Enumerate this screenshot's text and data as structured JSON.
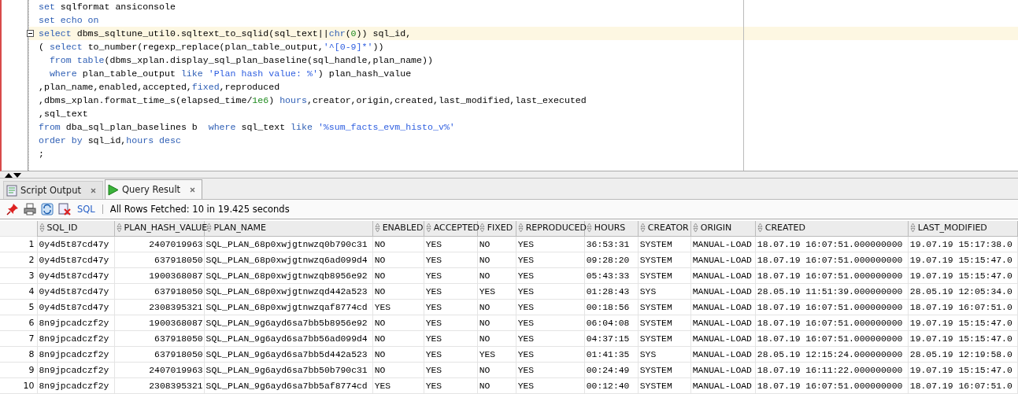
{
  "editor": {
    "lines": [
      {
        "current": false,
        "fold_marker": false,
        "tokens": [
          {
            "kind": "keyword",
            "text": "set"
          },
          {
            "kind": "plain",
            "text": " sqlformat ansiconsole"
          }
        ]
      },
      {
        "current": false,
        "fold_marker": false,
        "tokens": [
          {
            "kind": "keyword",
            "text": "set echo on"
          }
        ]
      },
      {
        "current": true,
        "fold_marker": true,
        "tokens": [
          {
            "kind": "keyword",
            "text": "select"
          },
          {
            "kind": "plain",
            "text": " dbms_sqltune_util0.sqltext_to_sqlid(sql_text||"
          },
          {
            "kind": "keyword",
            "text": "chr"
          },
          {
            "kind": "plain",
            "text": "("
          },
          {
            "kind": "number",
            "text": "0"
          },
          {
            "kind": "plain",
            "text": ")) sql_id,"
          }
        ]
      },
      {
        "current": false,
        "fold_marker": false,
        "tokens": [
          {
            "kind": "plain",
            "text": "( "
          },
          {
            "kind": "keyword",
            "text": "select"
          },
          {
            "kind": "plain",
            "text": " to_number(regexp_replace(plan_table_output,"
          },
          {
            "kind": "string",
            "text": "'^[0-9]*'"
          },
          {
            "kind": "plain",
            "text": "))"
          }
        ]
      },
      {
        "current": false,
        "fold_marker": false,
        "tokens": [
          {
            "kind": "keyword",
            "text": "  from"
          },
          {
            "kind": "keyword",
            "text": " table"
          },
          {
            "kind": "plain",
            "text": "(dbms_xplan.display_sql_plan_baseline(sql_handle,plan_name))"
          }
        ]
      },
      {
        "current": false,
        "fold_marker": false,
        "tokens": [
          {
            "kind": "keyword",
            "text": "  where"
          },
          {
            "kind": "plain",
            "text": " plan_table_output "
          },
          {
            "kind": "keyword",
            "text": "like"
          },
          {
            "kind": "string",
            "text": " 'Plan hash value: %'"
          },
          {
            "kind": "plain",
            "text": ") plan_hash_value"
          }
        ]
      },
      {
        "current": false,
        "fold_marker": false,
        "tokens": [
          {
            "kind": "plain",
            "text": ",plan_name,enabled,accepted,"
          },
          {
            "kind": "keyword",
            "text": "fixed"
          },
          {
            "kind": "plain",
            "text": ",reproduced"
          }
        ]
      },
      {
        "current": false,
        "fold_marker": false,
        "tokens": [
          {
            "kind": "plain",
            "text": ",dbms_xplan.format_time_s(elapsed_time/"
          },
          {
            "kind": "number",
            "text": "1e6"
          },
          {
            "kind": "plain",
            "text": ") "
          },
          {
            "kind": "keyword",
            "text": "hours"
          },
          {
            "kind": "plain",
            "text": ",creator,origin,created,last_modified,last_executed"
          }
        ]
      },
      {
        "current": false,
        "fold_marker": false,
        "tokens": [
          {
            "kind": "plain",
            "text": ",sql_text"
          }
        ]
      },
      {
        "current": false,
        "fold_marker": false,
        "tokens": [
          {
            "kind": "keyword",
            "text": "from"
          },
          {
            "kind": "plain",
            "text": " dba_sql_plan_baselines b  "
          },
          {
            "kind": "keyword",
            "text": "where"
          },
          {
            "kind": "plain",
            "text": " sql_text "
          },
          {
            "kind": "keyword",
            "text": "like"
          },
          {
            "kind": "string",
            "text": " '%sum_facts_evm_histo_v%'"
          }
        ]
      },
      {
        "current": false,
        "fold_marker": false,
        "tokens": [
          {
            "kind": "keyword",
            "text": "order by"
          },
          {
            "kind": "plain",
            "text": " sql_id,"
          },
          {
            "kind": "keyword",
            "text": "hours desc"
          }
        ]
      },
      {
        "current": false,
        "fold_marker": false,
        "tokens": [
          {
            "kind": "plain",
            "text": ";"
          }
        ]
      }
    ]
  },
  "tabs": [
    {
      "label": "Script Output",
      "kind": "script",
      "selected": false
    },
    {
      "label": "Query Result",
      "kind": "query",
      "selected": true
    }
  ],
  "toolbar": {
    "sql_link": "SQL",
    "status": "All Rows Fetched: 10 in 19.425 seconds"
  },
  "grid": {
    "columns": [
      {
        "name": "SQL_ID",
        "kind": "text"
      },
      {
        "name": "PLAN_HASH_VALUE",
        "kind": "number"
      },
      {
        "name": "PLAN_NAME",
        "kind": "text"
      },
      {
        "name": "ENABLED",
        "kind": "text"
      },
      {
        "name": "ACCEPTED",
        "kind": "text"
      },
      {
        "name": "FIXED",
        "kind": "text"
      },
      {
        "name": "REPRODUCED",
        "kind": "text"
      },
      {
        "name": "HOURS",
        "kind": "text"
      },
      {
        "name": "CREATOR",
        "kind": "text"
      },
      {
        "name": "ORIGIN",
        "kind": "text"
      },
      {
        "name": "CREATED",
        "kind": "text"
      },
      {
        "name": "LAST_MODIFIED",
        "kind": "text"
      }
    ],
    "rows": [
      {
        "number": "1",
        "cells": [
          "0y4d5t87cd47y",
          "2407019963",
          "SQL_PLAN_68p0xwjgtnwzq0b790c31",
          "NO",
          "YES",
          "NO",
          "YES",
          "36:53:31",
          "SYSTEM",
          "MANUAL-LOAD",
          "18.07.19 16:07:51.000000000",
          "19.07.19 15:17:38.0"
        ]
      },
      {
        "number": "2",
        "cells": [
          "0y4d5t87cd47y",
          "637918050",
          "SQL_PLAN_68p0xwjgtnwzq6ad099d4",
          "NO",
          "YES",
          "NO",
          "YES",
          "09:28:20",
          "SYSTEM",
          "MANUAL-LOAD",
          "18.07.19 16:07:51.000000000",
          "19.07.19 15:15:47.0"
        ]
      },
      {
        "number": "3",
        "cells": [
          "0y4d5t87cd47y",
          "1900368087",
          "SQL_PLAN_68p0xwjgtnwzqb8956e92",
          "NO",
          "YES",
          "NO",
          "YES",
          "05:43:33",
          "SYSTEM",
          "MANUAL-LOAD",
          "18.07.19 16:07:51.000000000",
          "19.07.19 15:15:47.0"
        ]
      },
      {
        "number": "4",
        "cells": [
          "0y4d5t87cd47y",
          "637918050",
          "SQL_PLAN_68p0xwjgtnwzqd442a523",
          "NO",
          "YES",
          "YES",
          "YES",
          "01:28:43",
          "SYS",
          "MANUAL-LOAD",
          "28.05.19 11:51:39.000000000",
          "28.05.19 12:05:34.0"
        ]
      },
      {
        "number": "5",
        "cells": [
          "0y4d5t87cd47y",
          "2308395321",
          "SQL_PLAN_68p0xwjgtnwzqaf8774cd",
          "YES",
          "YES",
          "NO",
          "YES",
          "00:18:56",
          "SYSTEM",
          "MANUAL-LOAD",
          "18.07.19 16:07:51.000000000",
          "18.07.19 16:07:51.0"
        ]
      },
      {
        "number": "6",
        "cells": [
          "8n9jpcadczf2y",
          "1900368087",
          "SQL_PLAN_9g6ayd6sa7bb5b8956e92",
          "NO",
          "YES",
          "NO",
          "YES",
          "06:04:08",
          "SYSTEM",
          "MANUAL-LOAD",
          "18.07.19 16:07:51.000000000",
          "19.07.19 15:15:47.0"
        ]
      },
      {
        "number": "7",
        "cells": [
          "8n9jpcadczf2y",
          "637918050",
          "SQL_PLAN_9g6ayd6sa7bb56ad099d4",
          "NO",
          "YES",
          "NO",
          "YES",
          "04:37:15",
          "SYSTEM",
          "MANUAL-LOAD",
          "18.07.19 16:07:51.000000000",
          "19.07.19 15:15:47.0"
        ]
      },
      {
        "number": "8",
        "cells": [
          "8n9jpcadczf2y",
          "637918050",
          "SQL_PLAN_9g6ayd6sa7bb5d442a523",
          "NO",
          "YES",
          "YES",
          "YES",
          "01:41:35",
          "SYS",
          "MANUAL-LOAD",
          "28.05.19 12:15:24.000000000",
          "28.05.19 12:19:58.0"
        ]
      },
      {
        "number": "9",
        "cells": [
          "8n9jpcadczf2y",
          "2407019963",
          "SQL_PLAN_9g6ayd6sa7bb50b790c31",
          "NO",
          "YES",
          "NO",
          "YES",
          "00:24:49",
          "SYSTEM",
          "MANUAL-LOAD",
          "18.07.19 16:11:22.000000000",
          "19.07.19 15:15:47.0"
        ]
      },
      {
        "number": "10",
        "cells": [
          "8n9jpcadczf2y",
          "2308395321",
          "SQL_PLAN_9g6ayd6sa7bb5af8774cd",
          "YES",
          "YES",
          "NO",
          "YES",
          "00:12:40",
          "SYSTEM",
          "MANUAL-LOAD",
          "18.07.19 16:07:51.000000000",
          "18.07.19 16:07:51.0"
        ]
      }
    ]
  }
}
